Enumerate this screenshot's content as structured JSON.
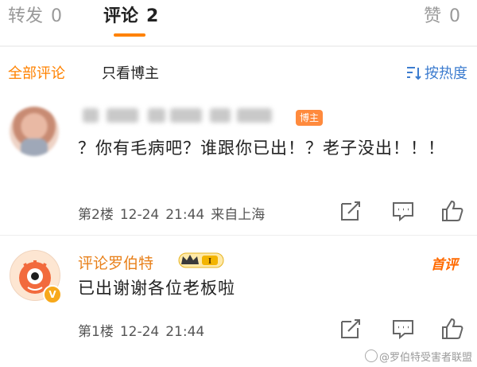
{
  "tabs": [
    {
      "label": "转发",
      "count": "0"
    },
    {
      "label": "评论",
      "count": "2"
    },
    {
      "label": "赞",
      "count": "0"
    }
  ],
  "filters": {
    "all": "全部评论",
    "poster_only": "只看博主",
    "sort": "按热度"
  },
  "accent_color": "#ff8200",
  "comments": [
    {
      "tag": "博主",
      "text": "？你有毛病吧？谁跟你已出！？老子没出！！！",
      "floor": "第2楼",
      "date": "12-24",
      "time": "21:44",
      "location": "来自上海"
    },
    {
      "author": "评论罗伯特",
      "level_badge": "I",
      "label": "首评",
      "text": "已出谢谢各位老板啦",
      "floor": "第1楼",
      "date": "12-24",
      "time": "21:44"
    }
  ],
  "watermark": "@罗伯特受害者联盟",
  "icons": [
    "forward-icon",
    "comment-icon",
    "like-icon",
    "sort-icon",
    "crown-icon"
  ]
}
